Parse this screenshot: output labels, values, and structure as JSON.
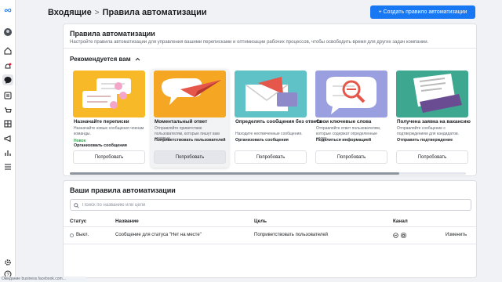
{
  "header": {
    "breadcrumb_parent": "Входящие",
    "breadcrumb_separator": ">",
    "title": "Правила автоматизации",
    "create_button": "+ Создать правило автоматизации"
  },
  "automation": {
    "title": "Правила автоматизации",
    "description": "Настройте правила автоматизации для управления вашими переписками и оптимизации рабочих процессов, чтобы освободить время для других задач компании.",
    "recommended_label": "Рекомендуется вам",
    "cards": [
      {
        "title": "Назначайте переписки",
        "description": "Назначайте новые сообщения членам команды.",
        "badge": "Новое",
        "action": "Организовать сообщения",
        "button": "Попробовать",
        "icon": "assign-chat-illustration"
      },
      {
        "title": "Моментальный ответ",
        "description": "Отправляйте приветствие пользователям, которые пишут вам впервые.",
        "badge": "",
        "action": "Поприветствовать пользователей",
        "button": "Попробовать",
        "icon": "paper-plane-illustration"
      },
      {
        "title": "Определять сообщения без ответа",
        "description": "Находите неотвеченные сообщения.",
        "badge": "",
        "action": "Организовать сообщения",
        "button": "Попробовать",
        "icon": "envelope-illustration"
      },
      {
        "title": "Свои ключевые слова",
        "description": "Отправляйте ответ пользователям, которые содержат определенные слова.",
        "badge": "",
        "action": "Поделиться информацией",
        "button": "Попробовать",
        "icon": "keyword-search-illustration"
      },
      {
        "title": "Получена заявка на вакансию",
        "description": "Отправляйте сообщение с подтверждением для кандидатов.",
        "badge": "",
        "action": "Отправить подтверждение",
        "button": "Попробовать",
        "icon": "application-illustration"
      }
    ]
  },
  "rules": {
    "title": "Ваши правила автоматизации",
    "search_placeholder": "Поиск по названию или цели",
    "columns": {
      "status": "Статус",
      "name": "Название",
      "goal": "Цель",
      "channel": "Канал"
    },
    "rows": [
      {
        "status": "Выкл.",
        "name": "Сообщение для статуса \"Нет на месте\"",
        "goal": "Поприветствовать пользователей",
        "channels": [
          "messenger-icon",
          "instagram-icon"
        ],
        "edit": "Изменить"
      }
    ]
  },
  "statusbar": "Ожидание business.facebook.com...",
  "colors": {
    "accent": "#1877f2",
    "new_badge": "#31a24c"
  }
}
